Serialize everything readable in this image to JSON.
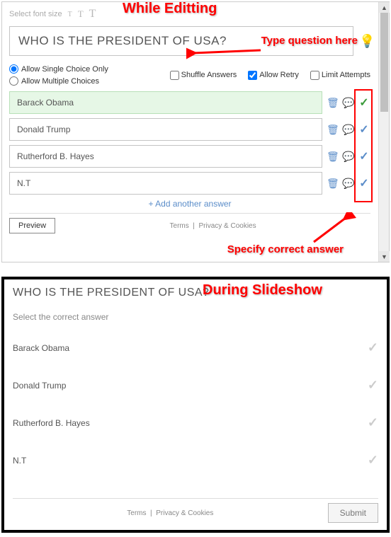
{
  "annotations": {
    "editing_title": "While Editting",
    "type_question": "Type question here",
    "specify_correct": "Specify correct answer",
    "slideshow_title": "During Slideshow"
  },
  "editor": {
    "toolbar": {
      "font_size_label": "Select font size"
    },
    "question": "WHO IS THE PRESIDENT OF USA?",
    "choice_mode": {
      "single_label": "Allow Single Choice Only",
      "multiple_label": "Allow Multiple Choices",
      "selected": "single"
    },
    "options": {
      "shuffle": {
        "label": "Shuffle Answers",
        "checked": false
      },
      "retry": {
        "label": "Allow Retry",
        "checked": true
      },
      "limit": {
        "label": "Limit Attempts",
        "checked": false
      }
    },
    "answers": [
      {
        "text": "Barack Obama",
        "correct": true
      },
      {
        "text": "Donald Trump",
        "correct": false
      },
      {
        "text": "Rutherford B. Hayes",
        "correct": false
      },
      {
        "text": "N.T",
        "correct": false
      }
    ],
    "add_answer_label": "Add another answer",
    "preview_label": "Preview",
    "footer": {
      "terms": "Terms",
      "privacy": "Privacy & Cookies"
    }
  },
  "slideshow": {
    "question": "WHO IS THE PRESIDENT OF USA?",
    "prompt": "Select the correct answer",
    "answers": [
      {
        "text": "Barack Obama"
      },
      {
        "text": "Donald Trump"
      },
      {
        "text": "Rutherford B. Hayes"
      },
      {
        "text": "N.T"
      }
    ],
    "footer": {
      "terms": "Terms",
      "privacy": "Privacy & Cookies"
    },
    "submit_label": "Submit"
  }
}
